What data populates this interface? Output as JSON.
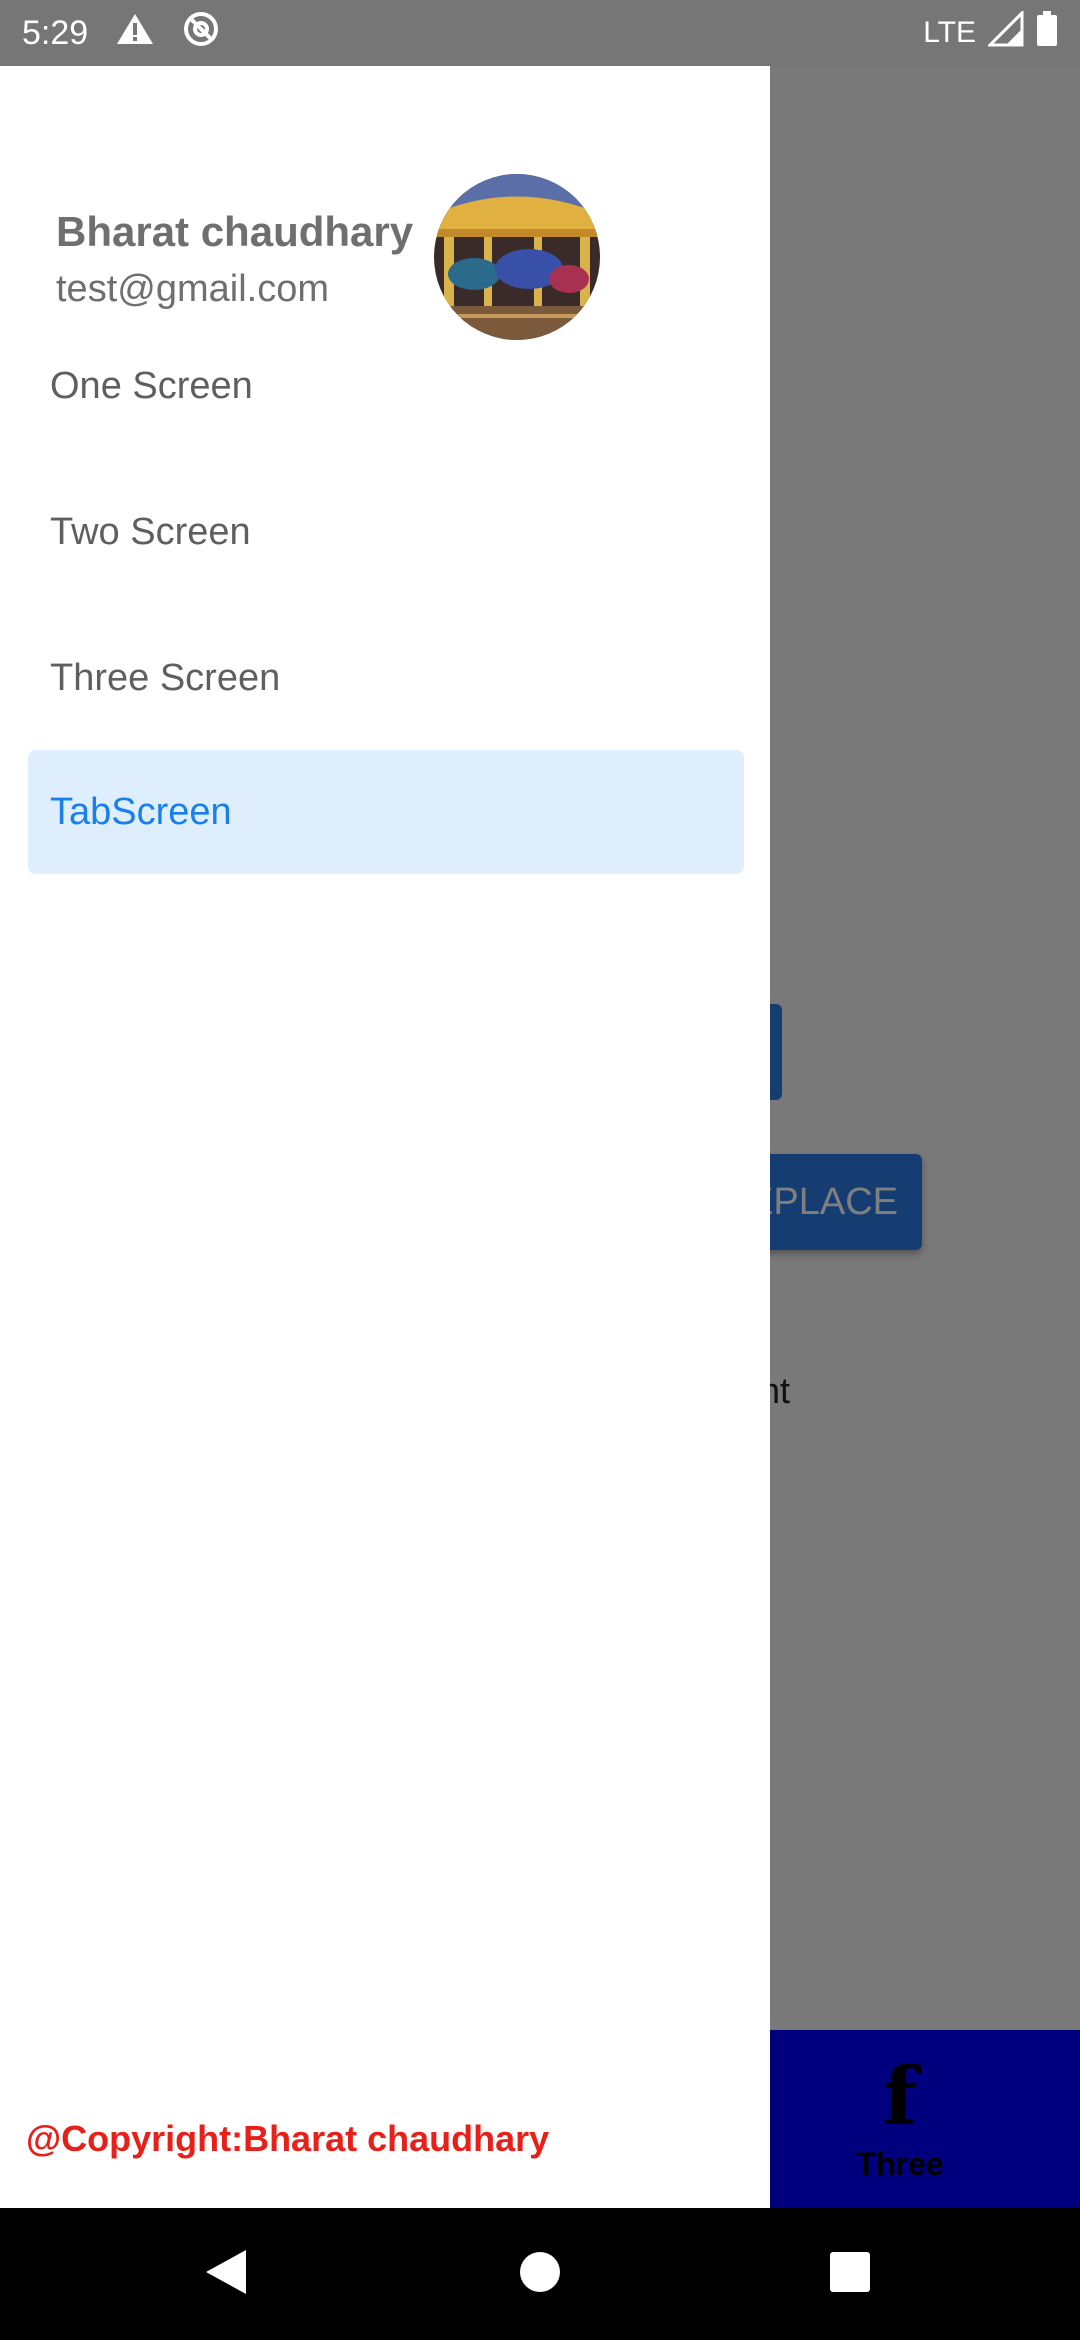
{
  "status_bar": {
    "time": "5:29",
    "network": "LTE",
    "icons": [
      "warning-icon",
      "do-not-disturb-icon",
      "signal-icon",
      "battery-icon"
    ]
  },
  "background_app": {
    "button_replace_fragment": "EPLACE",
    "text_fragment": "ent",
    "tab": {
      "icon": "facebook-icon",
      "icon_glyph": "f",
      "label": "Three"
    }
  },
  "drawer": {
    "user": {
      "name": "Bharat chaudhary",
      "email": "test@gmail.com",
      "avatar": "carousel-photo"
    },
    "items": [
      {
        "label": "One Screen",
        "active": false
      },
      {
        "label": "Two Screen",
        "active": false
      },
      {
        "label": "Three Screen",
        "active": false
      },
      {
        "label": "TabScreen",
        "active": true
      }
    ],
    "footer": "@Copyright:Bharat chaudhary"
  },
  "nav_bar": {
    "icons": [
      "back-icon",
      "home-icon",
      "recents-icon"
    ]
  },
  "colors": {
    "active_bg": "#deeefd",
    "active_text": "#1a7fe8",
    "copyright": "#e8201a",
    "tabbar": "#0000ff",
    "button": "#2c7be5"
  }
}
